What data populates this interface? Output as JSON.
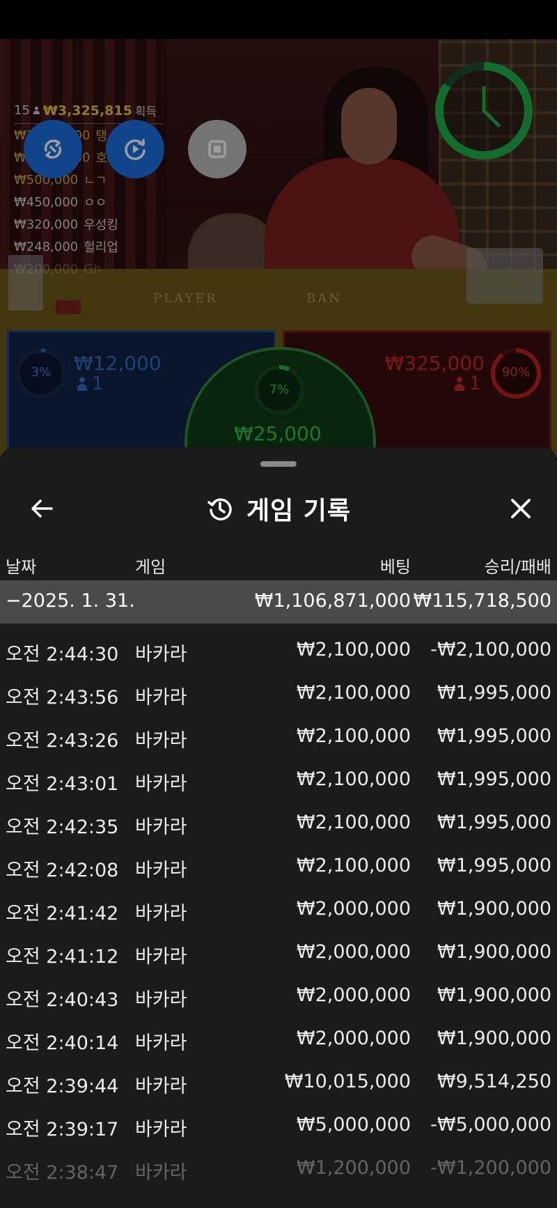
{
  "leaderboard": {
    "count": "15",
    "total": "₩3,325,815",
    "total_suffix": "획득",
    "entries": [
      {
        "amount": "₩1,000,000",
        "name": "탱"
      },
      {
        "amount": "₩1,000,000",
        "name": "호"
      },
      {
        "amount": "₩500,000",
        "name": "ㄴㄱ"
      },
      {
        "amount": "₩450,000",
        "name": "ㅇㅇ"
      },
      {
        "amount": "₩320,000",
        "name": "우성킹"
      },
      {
        "amount": "₩248,000",
        "name": "헐리업"
      },
      {
        "amount": "₩200,000",
        "name": "Gh"
      }
    ]
  },
  "table": {
    "player_label": "PLAYER",
    "banker_label": "BAN",
    "player": {
      "pct": "3%",
      "pct_value": 0.03,
      "stake": "₩12,000",
      "bettors": "1"
    },
    "banker": {
      "pct": "90%",
      "pct_value": 0.9,
      "stake": "₩325,000",
      "bettors": "1"
    },
    "tie": {
      "pct": "7%",
      "pct_value": 0.07,
      "stake": "₩25,000"
    }
  },
  "colors": {
    "player": "#1f5fb8",
    "banker": "#c42020",
    "tie": "#22b33d",
    "timer": "#1fae48",
    "fab_blue": "#1a6fe0",
    "summary_bg": "#4a4a4a",
    "sheet_bg": "#1b1b1b"
  },
  "icons": {
    "back": "arrow-left-icon",
    "history": "history-icon",
    "close": "close-icon",
    "fab1": "swap-icon",
    "fab2": "replay-icon",
    "fab3": "stop-icon",
    "timer": "clock-icon"
  },
  "history": {
    "title": "게임 기록",
    "columns": {
      "date": "날짜",
      "game": "게임",
      "bet": "베팅",
      "result": "승리/패배"
    },
    "summary": {
      "date": "−2025. 1. 31.",
      "bet": "₩1,106,871,000",
      "result": "₩115,718,500"
    },
    "rows": [
      {
        "time": "오전 2:44:30",
        "game": "바카라",
        "bet": "₩2,100,000",
        "result": "-₩2,100,000"
      },
      {
        "time": "오전 2:43:56",
        "game": "바카라",
        "bet": "₩2,100,000",
        "result": "₩1,995,000"
      },
      {
        "time": "오전 2:43:26",
        "game": "바카라",
        "bet": "₩2,100,000",
        "result": "₩1,995,000"
      },
      {
        "time": "오전 2:43:01",
        "game": "바카라",
        "bet": "₩2,100,000",
        "result": "₩1,995,000"
      },
      {
        "time": "오전 2:42:35",
        "game": "바카라",
        "bet": "₩2,100,000",
        "result": "₩1,995,000"
      },
      {
        "time": "오전 2:42:08",
        "game": "바카라",
        "bet": "₩2,100,000",
        "result": "₩1,995,000"
      },
      {
        "time": "오전 2:41:42",
        "game": "바카라",
        "bet": "₩2,000,000",
        "result": "₩1,900,000"
      },
      {
        "time": "오전 2:41:12",
        "game": "바카라",
        "bet": "₩2,000,000",
        "result": "₩1,900,000"
      },
      {
        "time": "오전 2:40:43",
        "game": "바카라",
        "bet": "₩2,000,000",
        "result": "₩1,900,000"
      },
      {
        "time": "오전 2:40:14",
        "game": "바카라",
        "bet": "₩2,000,000",
        "result": "₩1,900,000"
      },
      {
        "time": "오전 2:39:44",
        "game": "바카라",
        "bet": "₩10,015,000",
        "result": "₩9,514,250"
      },
      {
        "time": "오전 2:39:17",
        "game": "바카라",
        "bet": "₩5,000,000",
        "result": "-₩5,000,000"
      },
      {
        "time": "오전 2:38:47",
        "game": "바카라",
        "bet": "₩1,200,000",
        "result": "-₩1,200,000"
      }
    ]
  }
}
